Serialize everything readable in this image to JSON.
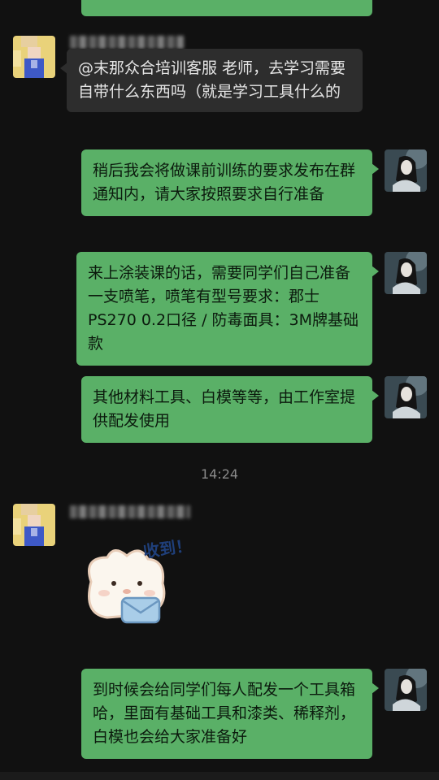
{
  "messages": [
    {
      "text": "@末那众合培训客服 老师，去学习需要自带什么东西吗（就是学习工具什么的"
    },
    {
      "text": "稍后我会将做课前训练的要求发布在群通知内，请大家按照要求自行准备"
    },
    {
      "text": "来上涂装课的话，需要同学们自己准备一支喷笔，喷笔有型号要求：郡士 PS270  0.2口径  / 防毒面具：3M牌基础款"
    },
    {
      "text": "其他材料工具、白模等等，由工作室提供配发使用"
    },
    {
      "text": "到时候会给同学们每人配发一个工具箱哈，里面有基础工具和漆类、稀释剂，白模也会给大家准备好"
    }
  ],
  "timestamp": "14:24",
  "sticker": {
    "text": "收到！"
  },
  "colors": {
    "background": "#111111",
    "green_bubble": "#5ab067",
    "gray_bubble": "#2d2d2d"
  }
}
